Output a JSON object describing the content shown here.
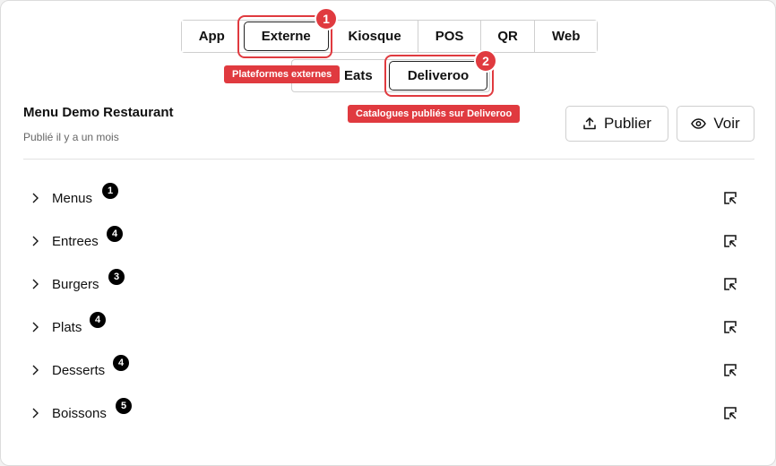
{
  "tabs": [
    {
      "label": "App"
    },
    {
      "label": "Externe"
    },
    {
      "label": "Kiosque"
    },
    {
      "label": "POS"
    },
    {
      "label": "QR"
    },
    {
      "label": "Web"
    }
  ],
  "subtabs": [
    {
      "label": "Eats"
    },
    {
      "label": "Deliveroo"
    }
  ],
  "annotations": [
    {
      "number": "1",
      "tooltip": "Plateformes externes"
    },
    {
      "number": "2",
      "tooltip": "Catalogues publiés sur Deliveroo"
    }
  ],
  "menu": {
    "title": "Menu Demo Restaurant",
    "subtitle": "Publié il y a un mois",
    "publish_label": "Publier",
    "view_label": "Voir"
  },
  "categories": [
    {
      "label": "Menus",
      "count": "1"
    },
    {
      "label": "Entrees",
      "count": "4"
    },
    {
      "label": "Burgers",
      "count": "3"
    },
    {
      "label": "Plats",
      "count": "4"
    },
    {
      "label": "Desserts",
      "count": "4"
    },
    {
      "label": "Boissons",
      "count": "5"
    }
  ],
  "colors": {
    "annotation_red": "#e03a3f",
    "count_badge": "#000000"
  },
  "icons": {
    "publish": "upload-icon",
    "view": "eye-icon",
    "expand": "chevron-right-icon",
    "edit": "edit-icon"
  }
}
